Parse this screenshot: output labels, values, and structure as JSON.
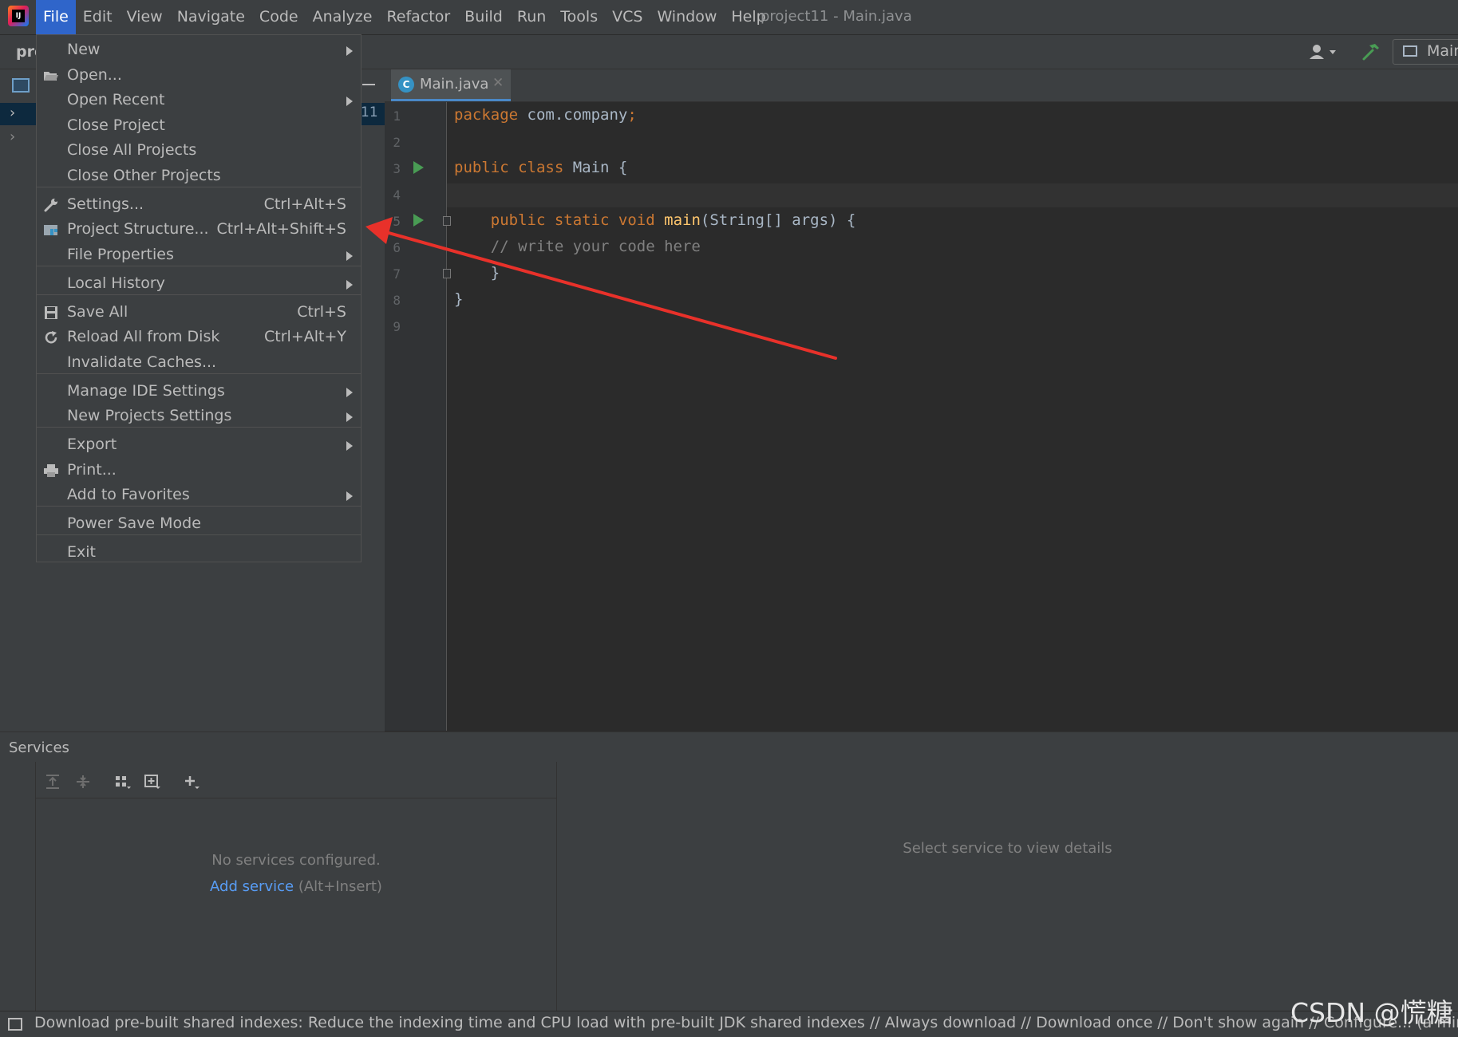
{
  "menubar": {
    "items": [
      "File",
      "Edit",
      "View",
      "Navigate",
      "Code",
      "Analyze",
      "Refactor",
      "Build",
      "Run",
      "Tools",
      "VCS",
      "Window",
      "Help"
    ],
    "active": "File",
    "window_title": "project11 - Main.java",
    "logo_text": "IJ"
  },
  "navbar": {
    "project_label": "pro",
    "run_config_label": "Main",
    "scope_label": "11"
  },
  "editor": {
    "tab_label": "Main.java",
    "tab_icon_letter": "C",
    "line_numbers": [
      "1",
      "2",
      "3",
      "4",
      "5",
      "6",
      "7",
      "8",
      "9"
    ]
  },
  "file_menu": {
    "items": [
      {
        "label": "New",
        "shortcut": "",
        "submenu": true
      },
      {
        "label": "Open...",
        "shortcut": "",
        "submenu": false
      },
      {
        "label": "Open Recent",
        "shortcut": "",
        "submenu": true
      },
      {
        "label": "Close Project",
        "shortcut": "",
        "submenu": false
      },
      {
        "label": "Close All Projects",
        "shortcut": "",
        "submenu": false
      },
      {
        "label": "Close Other Projects",
        "shortcut": "",
        "submenu": false
      },
      {
        "label": "Settings...",
        "shortcut": "Ctrl+Alt+S",
        "submenu": false
      },
      {
        "label": "Project Structure...",
        "shortcut": "Ctrl+Alt+Shift+S",
        "submenu": false
      },
      {
        "label": "File Properties",
        "shortcut": "",
        "submenu": true
      },
      {
        "label": "Local History",
        "shortcut": "",
        "submenu": true
      },
      {
        "label": "Save All",
        "shortcut": "Ctrl+S",
        "submenu": false
      },
      {
        "label": "Reload All from Disk",
        "shortcut": "Ctrl+Alt+Y",
        "submenu": false
      },
      {
        "label": "Invalidate Caches...",
        "shortcut": "",
        "submenu": false
      },
      {
        "label": "Manage IDE Settings",
        "shortcut": "",
        "submenu": true
      },
      {
        "label": "New Projects Settings",
        "shortcut": "",
        "submenu": true
      },
      {
        "label": "Export",
        "shortcut": "",
        "submenu": true
      },
      {
        "label": "Print...",
        "shortcut": "",
        "submenu": false
      },
      {
        "label": "Add to Favorites",
        "shortcut": "",
        "submenu": true
      },
      {
        "label": "Power Save Mode",
        "shortcut": "",
        "submenu": false
      },
      {
        "label": "Exit",
        "shortcut": "",
        "submenu": false
      }
    ]
  },
  "services": {
    "title": "Services",
    "empty_text": "No services configured.",
    "add_service_link": "Add service",
    "add_service_shortcut": "(Alt+Insert)",
    "details_placeholder": "Select service to view details"
  },
  "statusbar": {
    "message": "Download pre-built shared indexes: Reduce the indexing time and CPU load with pre-built JDK shared indexes // Always download // Download once // Don't show again // Configure... (a minute ago)"
  },
  "watermark": "CSDN @慌糖",
  "colors": {
    "menu_active": "#2f65ca",
    "keyword": "#cc7832",
    "function": "#ffc66d",
    "comment": "#808080",
    "link": "#589df6",
    "run_icon": "#499c54",
    "annotation_arrow": "#e8312a"
  }
}
